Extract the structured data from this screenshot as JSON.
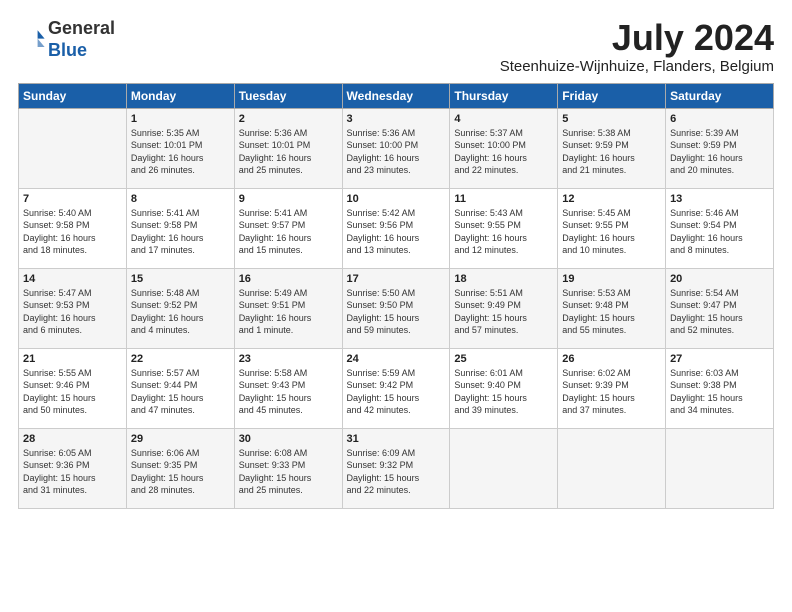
{
  "header": {
    "logo_general": "General",
    "logo_blue": "Blue",
    "month_title": "July 2024",
    "subtitle": "Steenhuize-Wijnhuize, Flanders, Belgium"
  },
  "days_of_week": [
    "Sunday",
    "Monday",
    "Tuesday",
    "Wednesday",
    "Thursday",
    "Friday",
    "Saturday"
  ],
  "weeks": [
    [
      {
        "day": "",
        "content": ""
      },
      {
        "day": "1",
        "content": "Sunrise: 5:35 AM\nSunset: 10:01 PM\nDaylight: 16 hours\nand 26 minutes."
      },
      {
        "day": "2",
        "content": "Sunrise: 5:36 AM\nSunset: 10:01 PM\nDaylight: 16 hours\nand 25 minutes."
      },
      {
        "day": "3",
        "content": "Sunrise: 5:36 AM\nSunset: 10:00 PM\nDaylight: 16 hours\nand 23 minutes."
      },
      {
        "day": "4",
        "content": "Sunrise: 5:37 AM\nSunset: 10:00 PM\nDaylight: 16 hours\nand 22 minutes."
      },
      {
        "day": "5",
        "content": "Sunrise: 5:38 AM\nSunset: 9:59 PM\nDaylight: 16 hours\nand 21 minutes."
      },
      {
        "day": "6",
        "content": "Sunrise: 5:39 AM\nSunset: 9:59 PM\nDaylight: 16 hours\nand 20 minutes."
      }
    ],
    [
      {
        "day": "7",
        "content": "Sunrise: 5:40 AM\nSunset: 9:58 PM\nDaylight: 16 hours\nand 18 minutes."
      },
      {
        "day": "8",
        "content": "Sunrise: 5:41 AM\nSunset: 9:58 PM\nDaylight: 16 hours\nand 17 minutes."
      },
      {
        "day": "9",
        "content": "Sunrise: 5:41 AM\nSunset: 9:57 PM\nDaylight: 16 hours\nand 15 minutes."
      },
      {
        "day": "10",
        "content": "Sunrise: 5:42 AM\nSunset: 9:56 PM\nDaylight: 16 hours\nand 13 minutes."
      },
      {
        "day": "11",
        "content": "Sunrise: 5:43 AM\nSunset: 9:55 PM\nDaylight: 16 hours\nand 12 minutes."
      },
      {
        "day": "12",
        "content": "Sunrise: 5:45 AM\nSunset: 9:55 PM\nDaylight: 16 hours\nand 10 minutes."
      },
      {
        "day": "13",
        "content": "Sunrise: 5:46 AM\nSunset: 9:54 PM\nDaylight: 16 hours\nand 8 minutes."
      }
    ],
    [
      {
        "day": "14",
        "content": "Sunrise: 5:47 AM\nSunset: 9:53 PM\nDaylight: 16 hours\nand 6 minutes."
      },
      {
        "day": "15",
        "content": "Sunrise: 5:48 AM\nSunset: 9:52 PM\nDaylight: 16 hours\nand 4 minutes."
      },
      {
        "day": "16",
        "content": "Sunrise: 5:49 AM\nSunset: 9:51 PM\nDaylight: 16 hours\nand 1 minute."
      },
      {
        "day": "17",
        "content": "Sunrise: 5:50 AM\nSunset: 9:50 PM\nDaylight: 15 hours\nand 59 minutes."
      },
      {
        "day": "18",
        "content": "Sunrise: 5:51 AM\nSunset: 9:49 PM\nDaylight: 15 hours\nand 57 minutes."
      },
      {
        "day": "19",
        "content": "Sunrise: 5:53 AM\nSunset: 9:48 PM\nDaylight: 15 hours\nand 55 minutes."
      },
      {
        "day": "20",
        "content": "Sunrise: 5:54 AM\nSunset: 9:47 PM\nDaylight: 15 hours\nand 52 minutes."
      }
    ],
    [
      {
        "day": "21",
        "content": "Sunrise: 5:55 AM\nSunset: 9:46 PM\nDaylight: 15 hours\nand 50 minutes."
      },
      {
        "day": "22",
        "content": "Sunrise: 5:57 AM\nSunset: 9:44 PM\nDaylight: 15 hours\nand 47 minutes."
      },
      {
        "day": "23",
        "content": "Sunrise: 5:58 AM\nSunset: 9:43 PM\nDaylight: 15 hours\nand 45 minutes."
      },
      {
        "day": "24",
        "content": "Sunrise: 5:59 AM\nSunset: 9:42 PM\nDaylight: 15 hours\nand 42 minutes."
      },
      {
        "day": "25",
        "content": "Sunrise: 6:01 AM\nSunset: 9:40 PM\nDaylight: 15 hours\nand 39 minutes."
      },
      {
        "day": "26",
        "content": "Sunrise: 6:02 AM\nSunset: 9:39 PM\nDaylight: 15 hours\nand 37 minutes."
      },
      {
        "day": "27",
        "content": "Sunrise: 6:03 AM\nSunset: 9:38 PM\nDaylight: 15 hours\nand 34 minutes."
      }
    ],
    [
      {
        "day": "28",
        "content": "Sunrise: 6:05 AM\nSunset: 9:36 PM\nDaylight: 15 hours\nand 31 minutes."
      },
      {
        "day": "29",
        "content": "Sunrise: 6:06 AM\nSunset: 9:35 PM\nDaylight: 15 hours\nand 28 minutes."
      },
      {
        "day": "30",
        "content": "Sunrise: 6:08 AM\nSunset: 9:33 PM\nDaylight: 15 hours\nand 25 minutes."
      },
      {
        "day": "31",
        "content": "Sunrise: 6:09 AM\nSunset: 9:32 PM\nDaylight: 15 hours\nand 22 minutes."
      },
      {
        "day": "",
        "content": ""
      },
      {
        "day": "",
        "content": ""
      },
      {
        "day": "",
        "content": ""
      }
    ]
  ]
}
